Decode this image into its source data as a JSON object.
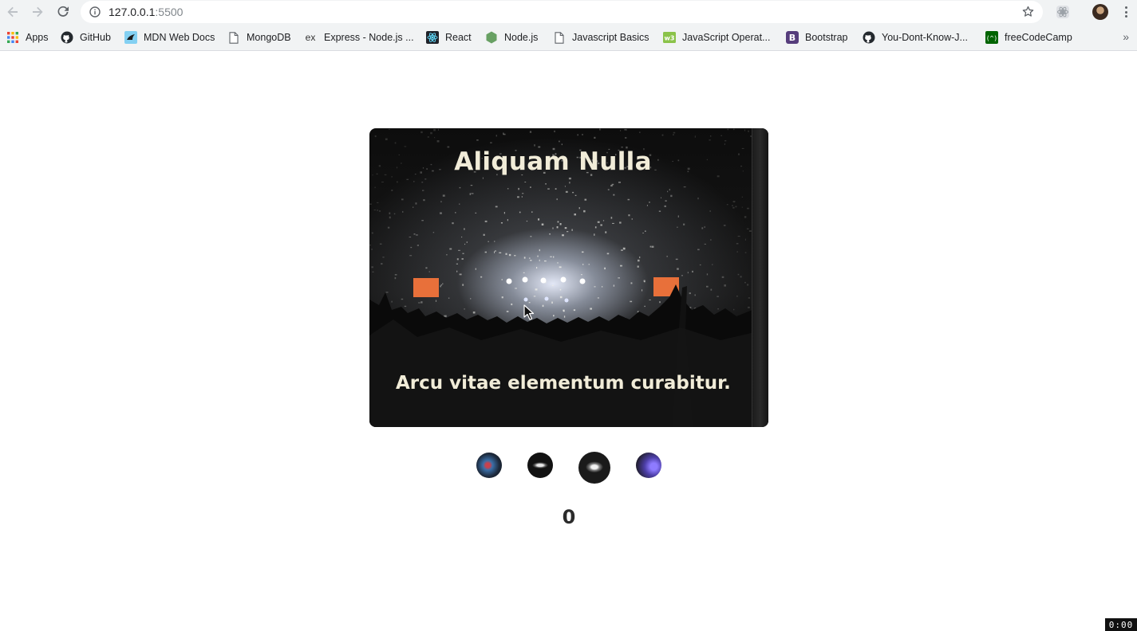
{
  "browser": {
    "url_host": "127.0.0.1",
    "url_port": ":5500",
    "bookmarks": [
      {
        "label": "Apps",
        "icon": "apps-grid-icon"
      },
      {
        "label": "GitHub",
        "icon": "github-icon"
      },
      {
        "label": "MDN Web Docs",
        "icon": "mdn-icon"
      },
      {
        "label": "MongoDB",
        "icon": "page-icon"
      },
      {
        "label": "Express - Node.js ...",
        "icon": "express-icon"
      },
      {
        "label": "React",
        "icon": "react-icon"
      },
      {
        "label": "Node.js",
        "icon": "nodejs-icon"
      },
      {
        "label": "Javascript Basics",
        "icon": "page-icon"
      },
      {
        "label": "JavaScript Operat...",
        "icon": "w3-icon"
      },
      {
        "label": "Bootstrap",
        "icon": "bootstrap-icon"
      },
      {
        "label": "You-Dont-Know-J...",
        "icon": "github-icon"
      },
      {
        "label": "freeCodeCamp",
        "icon": "freecodecamp-icon"
      }
    ]
  },
  "slider": {
    "title": "Aliquam Nulla",
    "caption": "Arcu vitae elementum curabitur.",
    "image": "concert-crowd-confetti"
  },
  "thumbnails": [
    {
      "image": "concert-red-blue-lights",
      "active": false
    },
    {
      "image": "stage-dark",
      "active": false
    },
    {
      "image": "concert-crowd-confetti",
      "active": true
    },
    {
      "image": "concert-purple-lights",
      "active": false
    }
  ],
  "counter": "0",
  "recording_badge": "0:00",
  "colors": {
    "caption_text": "#f1ecd8",
    "counter_text": "#2b2b2b",
    "chrome_bg": "#f1f3f4"
  }
}
